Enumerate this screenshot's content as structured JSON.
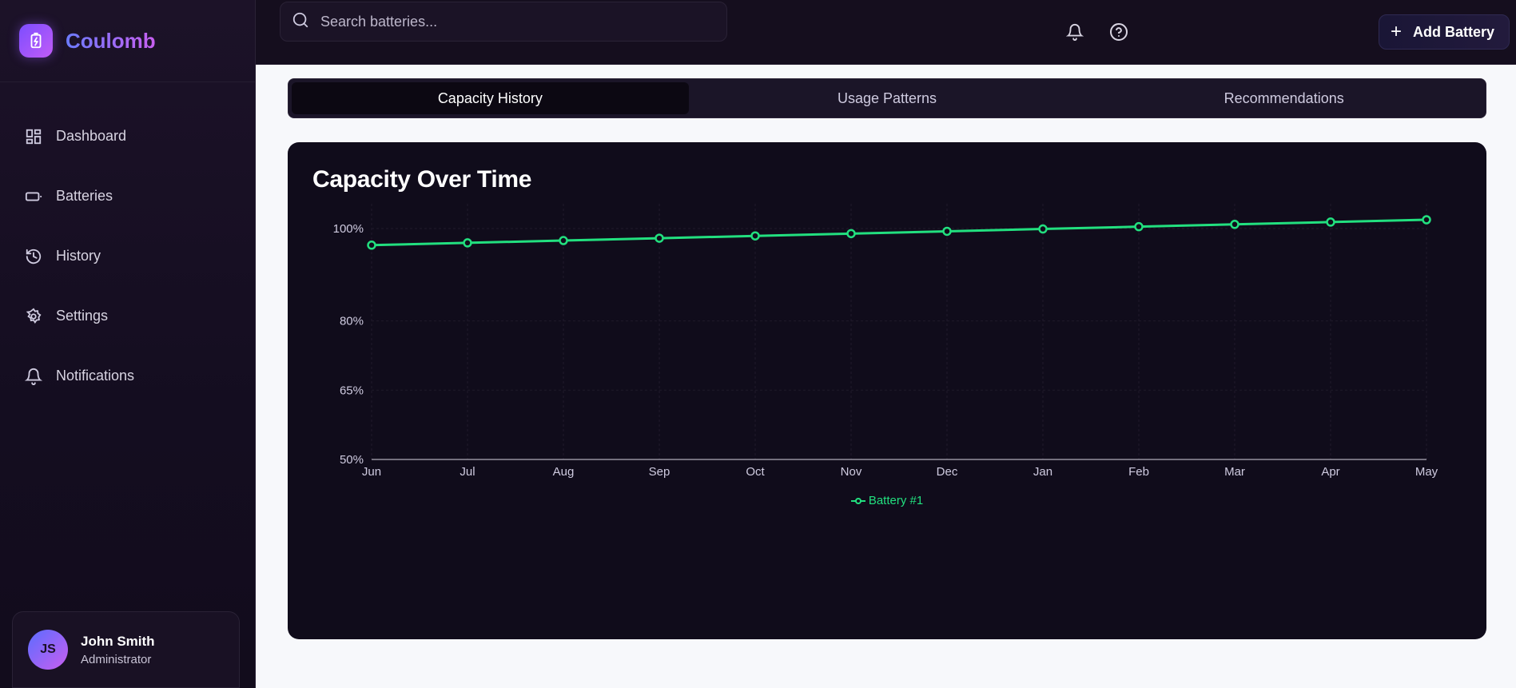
{
  "app": {
    "name": "Coulomb"
  },
  "sidebar": {
    "items": [
      {
        "label": "Dashboard",
        "icon": "dashboard-icon"
      },
      {
        "label": "Batteries",
        "icon": "battery-icon"
      },
      {
        "label": "History",
        "icon": "history-icon"
      },
      {
        "label": "Settings",
        "icon": "gear-icon"
      },
      {
        "label": "Notifications",
        "icon": "bell-icon"
      }
    ],
    "user": {
      "initials": "JS",
      "name": "John Smith",
      "role": "Administrator"
    }
  },
  "topbar": {
    "search_placeholder": "Search batteries...",
    "add_button_label": "Add Battery"
  },
  "tabs": [
    {
      "label": "Capacity History",
      "active": true
    },
    {
      "label": "Usage Patterns",
      "active": false
    },
    {
      "label": "Recommendations",
      "active": false
    }
  ],
  "card": {
    "title": "Capacity Over Time"
  },
  "colors": {
    "series": "#22e07f",
    "accent": "#8b5cf6",
    "background": "#100c1b"
  },
  "chart_data": {
    "type": "line",
    "title": "Capacity Over Time",
    "categories": [
      "Jun",
      "Jul",
      "Aug",
      "Sep",
      "Oct",
      "Nov",
      "Dec",
      "Jan",
      "Feb",
      "Mar",
      "Apr",
      "May"
    ],
    "series": [
      {
        "name": "Battery #1",
        "values": [
          96.4,
          96.9,
          97.4,
          97.9,
          98.4,
          98.9,
          99.4,
          99.9,
          100.4,
          100.9,
          101.4,
          101.9
        ]
      }
    ],
    "yticks": [
      50,
      65,
      80,
      100
    ],
    "ytick_labels": [
      "50%",
      "65%",
      "80%",
      "100%"
    ],
    "ylim": [
      50,
      101.9
    ],
    "grid": true,
    "legend": "bottom-center"
  }
}
